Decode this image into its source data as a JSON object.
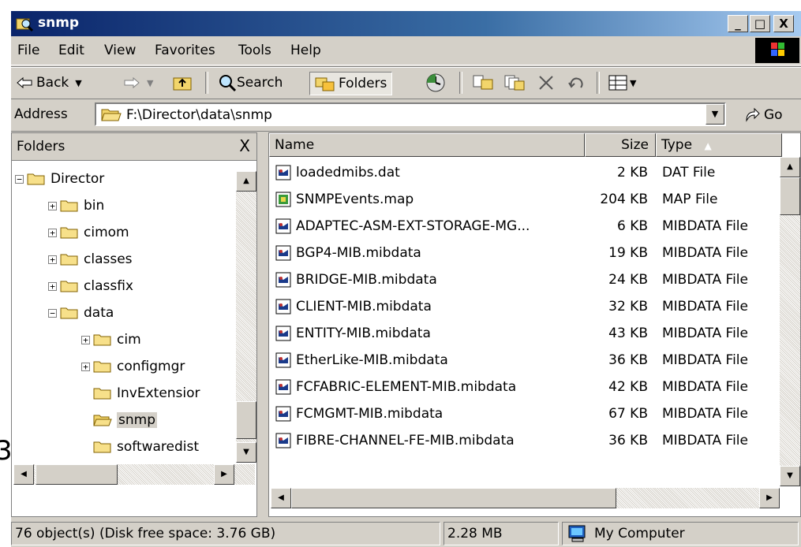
{
  "window": {
    "title": "snmp",
    "minimize": "_",
    "maximize": "□",
    "close": "X"
  },
  "menu": [
    {
      "label": "File"
    },
    {
      "label": "Edit"
    },
    {
      "label": "View"
    },
    {
      "label": "Favorites"
    },
    {
      "label": "Tools"
    },
    {
      "label": "Help"
    }
  ],
  "toolbar": {
    "back": "Back",
    "search": "Search",
    "folders": "Folders"
  },
  "address": {
    "label": "Address",
    "value": "F:\\Director\\data\\snmp",
    "go": "Go"
  },
  "folders_pane": {
    "title": "Folders",
    "close": "X",
    "tree": [
      {
        "label": "Director",
        "expander": "−",
        "level": 0
      },
      {
        "label": "bin",
        "expander": "+",
        "level": 1
      },
      {
        "label": "cimom",
        "expander": "+",
        "level": 1
      },
      {
        "label": "classes",
        "expander": "+",
        "level": 1
      },
      {
        "label": "classfix",
        "expander": "+",
        "level": 1
      },
      {
        "label": "data",
        "expander": "−",
        "level": 1
      },
      {
        "label": "cim",
        "expander": "+",
        "level": 2
      },
      {
        "label": "configmgr",
        "expander": "+",
        "level": 2
      },
      {
        "label": "InvExtensior",
        "expander": "",
        "level": 2
      },
      {
        "label": "snmp",
        "expander": "",
        "level": 2,
        "selected": true
      },
      {
        "label": "softwaredist",
        "expander": "",
        "level": 2
      }
    ]
  },
  "file_list": {
    "columns": {
      "name": "Name",
      "size": "Size",
      "type": "Type"
    },
    "rows": [
      {
        "name": "loadedmibs.dat",
        "size": "2 KB",
        "type": "DAT File"
      },
      {
        "name": "SNMPEvents.map",
        "size": "204 KB",
        "type": "MAP File"
      },
      {
        "name": "ADAPTEC-ASM-EXT-STORAGE-MG...",
        "size": "6 KB",
        "type": "MIBDATA File"
      },
      {
        "name": "BGP4-MIB.mibdata",
        "size": "19 KB",
        "type": "MIBDATA File"
      },
      {
        "name": "BRIDGE-MIB.mibdata",
        "size": "24 KB",
        "type": "MIBDATA File"
      },
      {
        "name": "CLIENT-MIB.mibdata",
        "size": "32 KB",
        "type": "MIBDATA File"
      },
      {
        "name": "ENTITY-MIB.mibdata",
        "size": "43 KB",
        "type": "MIBDATA File"
      },
      {
        "name": "EtherLike-MIB.mibdata",
        "size": "36 KB",
        "type": "MIBDATA File"
      },
      {
        "name": "FCFABRIC-ELEMENT-MIB.mibdata",
        "size": "42 KB",
        "type": "MIBDATA File"
      },
      {
        "name": "FCMGMT-MIB.mibdata",
        "size": "67 KB",
        "type": "MIBDATA File"
      },
      {
        "name": "FIBRE-CHANNEL-FE-MIB.mibdata",
        "size": "36 KB",
        "type": "MIBDATA File"
      }
    ]
  },
  "status": {
    "objects": "76 object(s) (Disk free space: 3.76 GB)",
    "size": "2.28 MB",
    "zone": "My Computer"
  },
  "edge_text": "3"
}
